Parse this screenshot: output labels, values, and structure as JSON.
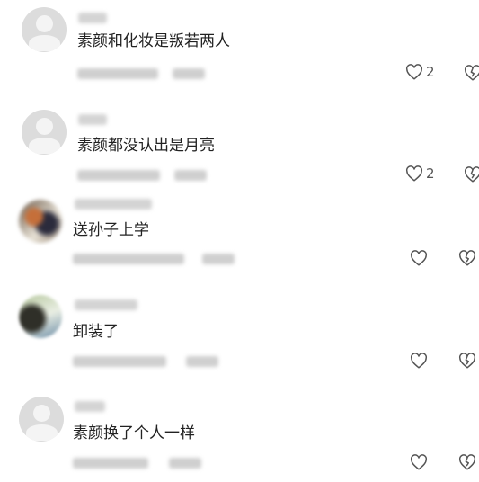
{
  "comments": [
    {
      "text": "素颜和化妆是叛若两人",
      "likes": "2",
      "avatar": "default"
    },
    {
      "text": "素颜都没认出是月亮",
      "likes": "2",
      "avatar": "default"
    },
    {
      "text": "送孙子上学",
      "likes": "",
      "avatar": "photo1"
    },
    {
      "text": "卸装了",
      "likes": "",
      "avatar": "photo2"
    },
    {
      "text": "素颜换了个人一样",
      "likes": "",
      "avatar": "default"
    }
  ],
  "icons": {
    "like": "heart-outline-icon",
    "dislike": "broken-heart-outline-icon"
  },
  "colors": {
    "text": "#222222",
    "icon": "#555555",
    "blur_placeholder": "#d4d4d4"
  }
}
